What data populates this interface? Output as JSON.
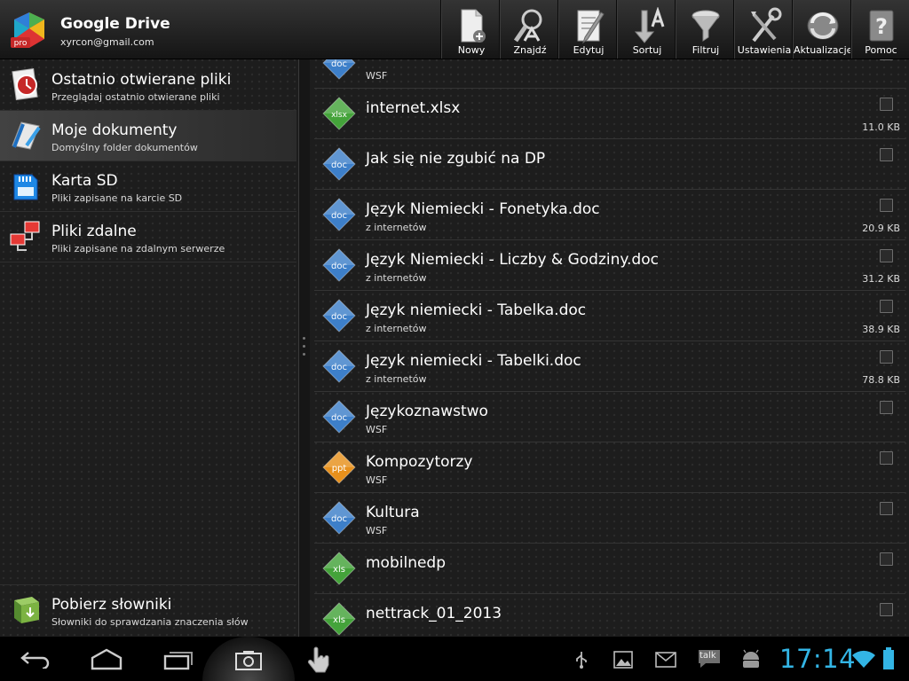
{
  "app": {
    "title": "Google Drive",
    "account": "xyrcon@gmail.com",
    "logo_icon": "ophiiapp-pro-logo"
  },
  "toolbar": [
    {
      "label": "Nowy",
      "icon": "new-document-icon"
    },
    {
      "label": "Znajdź",
      "icon": "search-icon"
    },
    {
      "label": "Edytuj",
      "icon": "edit-icon"
    },
    {
      "label": "Sortuj",
      "icon": "sort-icon"
    },
    {
      "label": "Filtruj",
      "icon": "filter-icon"
    },
    {
      "label": "Ustawienia",
      "icon": "settings-icon"
    },
    {
      "label": "Aktualizacje",
      "icon": "updates-icon"
    },
    {
      "label": "Pomoc",
      "icon": "help-icon"
    }
  ],
  "sidebar": {
    "items": [
      {
        "title": "Ostatnio otwierane pliki",
        "subtitle": "Przeglądaj ostatnio otwierane pliki",
        "icon": "recent-files-icon"
      },
      {
        "title": "Moje dokumenty",
        "subtitle": "Domyślny folder dokumentów",
        "icon": "my-documents-icon",
        "selected": true
      },
      {
        "title": "Karta SD",
        "subtitle": "Pliki zapisane na karcie SD",
        "icon": "sd-card-icon"
      },
      {
        "title": "Pliki zdalne",
        "subtitle": "Pliki zapisane na zdalnym serwerze",
        "icon": "remote-files-icon"
      }
    ],
    "bottom": {
      "title": "Pobierz słowniki",
      "subtitle": "Słowniki do sprawdzania znaczenia słów",
      "icon": "download-dictionaries-icon"
    }
  },
  "files": [
    {
      "name": "",
      "sub": "WSF",
      "size": "",
      "type": "doc"
    },
    {
      "name": "internet.xlsx",
      "sub": "",
      "size": "11.0 KB",
      "type": "xlsx"
    },
    {
      "name": "Jak się nie zgubić na DP",
      "sub": "",
      "size": "",
      "type": "doc"
    },
    {
      "name": "Język Niemiecki - Fonetyka.doc",
      "sub": "z internetów",
      "size": "20.9 KB",
      "type": "doc"
    },
    {
      "name": "Język Niemiecki - Liczby & Godziny.doc",
      "sub": "z internetów",
      "size": "31.2 KB",
      "type": "doc"
    },
    {
      "name": "Język niemiecki - Tabelka.doc",
      "sub": "z internetów",
      "size": "38.9 KB",
      "type": "doc"
    },
    {
      "name": "Język niemiecki - Tabelki.doc",
      "sub": "z internetów",
      "size": "78.8 KB",
      "type": "doc"
    },
    {
      "name": "Językoznawstwo",
      "sub": "WSF",
      "size": "",
      "type": "doc"
    },
    {
      "name": "Kompozytorzy",
      "sub": "WSF",
      "size": "",
      "type": "ppt"
    },
    {
      "name": "Kultura",
      "sub": "WSF",
      "size": "",
      "type": "doc"
    },
    {
      "name": "mobilnedp",
      "sub": "",
      "size": "",
      "type": "xls"
    },
    {
      "name": "nettrack_01_2013",
      "sub": "",
      "size": "",
      "type": "xls"
    }
  ],
  "file_type_colors": {
    "doc": "#3d7fc9",
    "xls": "#44a33a",
    "xlsx": "#44a33a",
    "ppt": "#e7901c"
  },
  "navbar": {
    "buttons": [
      "back-icon",
      "home-icon",
      "recent-apps-icon",
      "screenshot-icon",
      "touch-icon"
    ],
    "status_icons": [
      "usb-icon",
      "gallery-icon",
      "gmail-icon",
      "talk-icon",
      "android-icon"
    ],
    "talk_text": "talk",
    "clock": "17:14",
    "accent": "#33b5e5"
  }
}
